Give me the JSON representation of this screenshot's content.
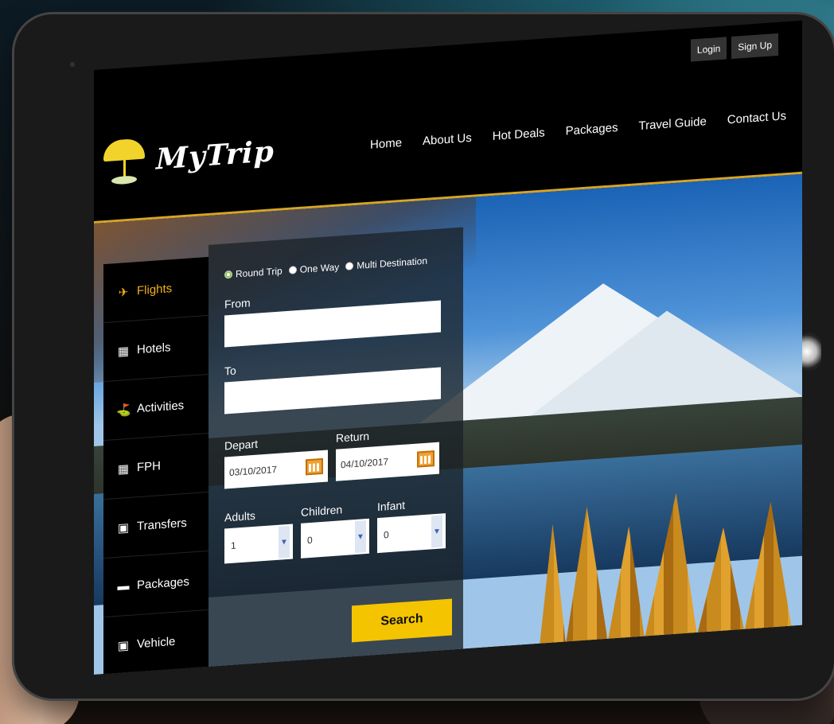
{
  "header": {
    "auth": {
      "login": "Login",
      "signup": "Sign Up"
    },
    "logo_text": "MyTrip",
    "nav": [
      "Home",
      "About Us",
      "Hot Deals",
      "Packages",
      "Travel Guide",
      "Contact Us"
    ]
  },
  "sidebar": {
    "items": [
      {
        "label": "Flights",
        "icon": "plane-icon"
      },
      {
        "label": "Hotels",
        "icon": "building-icon"
      },
      {
        "label": "Activities",
        "icon": "golfer-icon"
      },
      {
        "label": "FPH",
        "icon": "building-icon"
      },
      {
        "label": "Transfers",
        "icon": "car-icon"
      },
      {
        "label": "Packages",
        "icon": "package-icon"
      },
      {
        "label": "Vehicle",
        "icon": "car-icon"
      }
    ]
  },
  "search": {
    "trip_types": [
      "Round Trip",
      "One Way",
      "Multi Destination"
    ],
    "from_label": "From",
    "to_label": "To",
    "depart_label": "Depart",
    "return_label": "Return",
    "depart_value": "03/10/2017",
    "return_value": "04/10/2017",
    "adults_label": "Adults",
    "children_label": "Children",
    "infant_label": "Infant",
    "adults_value": "1",
    "children_value": "0",
    "infant_value": "0",
    "search_label": "Search"
  },
  "colors": {
    "accent": "#f5c400",
    "active_menu": "#f2b21c",
    "gold_line": "#d7a526"
  }
}
